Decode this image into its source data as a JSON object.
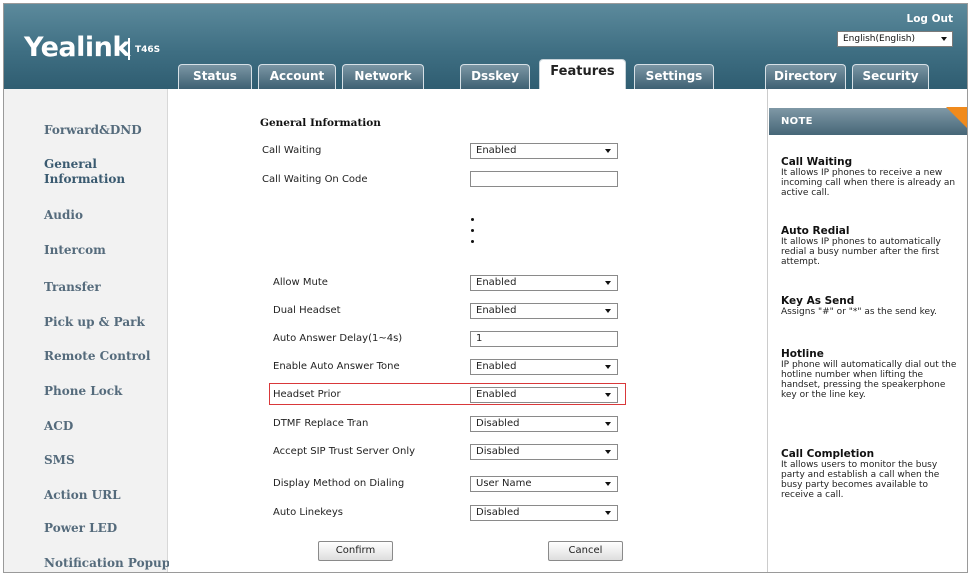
{
  "header": {
    "logo": "Yealink",
    "model": "T46S",
    "logout": "Log Out",
    "language": "English(English)",
    "tabs": [
      "Status",
      "Account",
      "Network",
      "Dsskey",
      "Features",
      "Settings",
      "Directory",
      "Security"
    ],
    "active_tab": "Features"
  },
  "sidebar": {
    "items": [
      "Forward&DND",
      "General Information",
      "Audio",
      "Intercom",
      "Transfer",
      "Pick up & Park",
      "Remote Control",
      "Phone Lock",
      "ACD",
      "SMS",
      "Action URL",
      "Power LED",
      "Notification Popups"
    ],
    "active_item": "General Information"
  },
  "main": {
    "section_title": "General Information",
    "rows": [
      {
        "label": "Call Waiting",
        "type": "select",
        "value": "Enabled"
      },
      {
        "label": "Call Waiting On Code",
        "type": "text",
        "value": ""
      },
      {
        "label": "Allow Mute",
        "type": "select",
        "value": "Enabled"
      },
      {
        "label": "Dual Headset",
        "type": "select",
        "value": "Enabled"
      },
      {
        "label": "Auto Answer Delay(1~4s)",
        "type": "text",
        "value": "1"
      },
      {
        "label": "Enable Auto Answer Tone",
        "type": "select",
        "value": "Enabled"
      },
      {
        "label": "Headset Prior",
        "type": "select",
        "value": "Enabled",
        "highlighted": true
      },
      {
        "label": "DTMF Replace Tran",
        "type": "select",
        "value": "Disabled"
      },
      {
        "label": "Accept SIP Trust Server Only",
        "type": "select",
        "value": "Disabled"
      },
      {
        "label": "Display Method on Dialing",
        "type": "select",
        "value": "User Name"
      },
      {
        "label": "Auto Linekeys",
        "type": "select",
        "value": "Disabled"
      }
    ],
    "confirm_label": "Confirm",
    "cancel_label": "Cancel",
    "highlight_color": "#d9383a"
  },
  "note": {
    "header": "NOTE",
    "accent_color": "#f08a1c",
    "entries": [
      {
        "title": "Call Waiting",
        "text": "It allows IP phones to receive a new incoming call when there is already an active call."
      },
      {
        "title": "Auto Redial",
        "text": "It allows IP phones to automatically redial a busy number after the first attempt."
      },
      {
        "title": "Key As Send",
        "text": "Assigns \"#\" or \"*\" as the send key."
      },
      {
        "title": "Hotline",
        "text": "IP phone will automatically dial out the hotline number when lifting the handset, pressing the speakerphone key or the line key."
      },
      {
        "title": "Call Completion",
        "text": "It allows users to monitor the busy party and establish a call when the busy party becomes available to receive a call."
      }
    ]
  }
}
